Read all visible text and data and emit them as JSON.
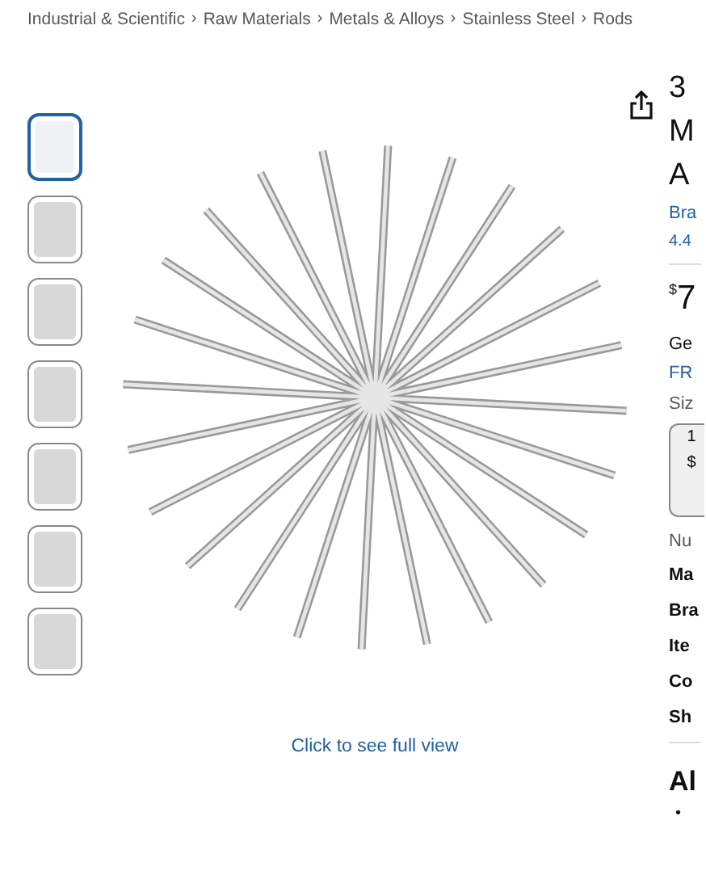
{
  "breadcrumb": [
    {
      "label": "Industrial & Scientific",
      "separator": "›"
    },
    {
      "label": "Raw Materials",
      "separator": "›"
    },
    {
      "label": "Metals & Alloys",
      "separator": "›"
    },
    {
      "label": "Stainless Steel",
      "separator": "›"
    },
    {
      "label": "Rods"
    }
  ],
  "thumbnails": [
    {
      "selected": true
    },
    {
      "selected": false
    },
    {
      "selected": false
    },
    {
      "selected": false
    },
    {
      "selected": false
    },
    {
      "selected": false
    },
    {
      "selected": false
    }
  ],
  "image_caption": "Click to see full view",
  "product": {
    "title_lines": [
      "3",
      "M",
      "A"
    ],
    "brand_link": "Bra",
    "rating": "4.4",
    "price_symbol": "$",
    "price": "7",
    "delivery_lines": [
      "Ge",
      "FR"
    ],
    "size_label": "Siz",
    "size_option_lines": [
      "1",
      "$"
    ],
    "quantity_label": "Nu",
    "spec_labels": [
      "Ma",
      "Bra",
      "Ite",
      "Co",
      "Sh"
    ],
    "about_heading": "Al",
    "bullet_marker": "•"
  }
}
